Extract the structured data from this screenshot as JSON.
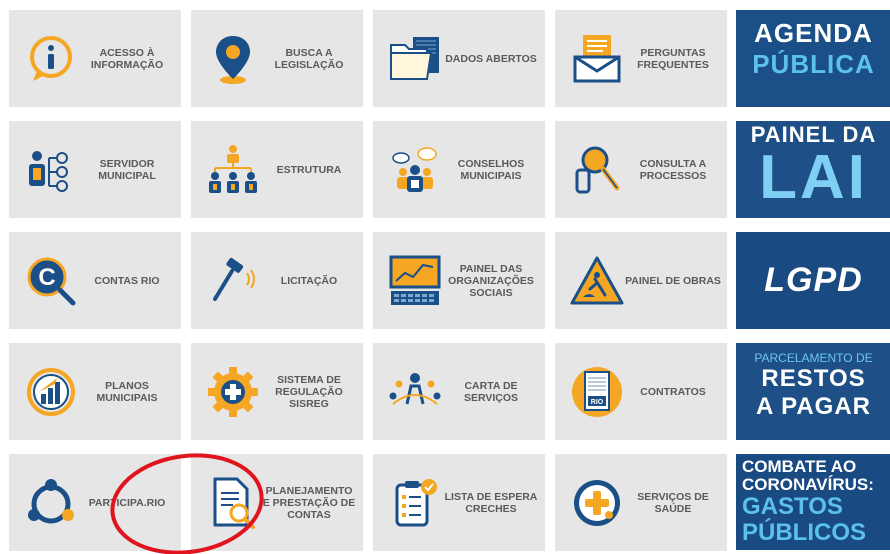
{
  "tiles": [
    {
      "label": "ACESSO À INFORMAÇÃO"
    },
    {
      "label": "BUSCA A LEGISLAÇÃO"
    },
    {
      "label": "DADOS ABERTOS"
    },
    {
      "label": "PERGUNTAS FREQUENTES"
    },
    {
      "label": "SERVIDOR MUNICIPAL"
    },
    {
      "label": "ESTRUTURA"
    },
    {
      "label": "CONSELHOS MUNICIPAIS"
    },
    {
      "label": "CONSULTA A PROCESSOS"
    },
    {
      "label": "CONTAS RIO"
    },
    {
      "label": "LICITAÇÃO"
    },
    {
      "label": "PAINEL DAS ORGANIZAÇÕES SOCIAIS"
    },
    {
      "label": "PAINEL DE OBRAS"
    },
    {
      "label": "PLANOS MUNICIPAIS"
    },
    {
      "label": "SISTEMA DE REGULAÇÃO SISREG"
    },
    {
      "label": "CARTA DE SERVIÇOS"
    },
    {
      "label": "CONTRATOS"
    },
    {
      "label": "PARTICIPA.RIO"
    },
    {
      "label": "PLANEJAMENTO E PRESTAÇÃO DE CONTAS"
    },
    {
      "label": "LISTA DE ESPERA CRECHES"
    },
    {
      "label": "SERVIÇOS DE SAÚDE"
    }
  ],
  "banners": {
    "agenda": {
      "line1": "AGENDA",
      "line2": "PÚBLICA"
    },
    "painel_lai": {
      "line1": "PAINEL DA",
      "line2": "LAI"
    },
    "lgpd": {
      "line1": "LGPD"
    },
    "restos": {
      "line1": "PARCELAMENTO DE",
      "line2": "RESTOS",
      "line3": "A PAGAR"
    },
    "coronavirus": {
      "line1": "COMBATE AO",
      "line2": "CORONAVÍRUS:",
      "line3": "GASTOS",
      "line4": "PÚBLICOS"
    }
  },
  "annotation": {
    "color": "#e0141e"
  },
  "colors": {
    "icon_blue": "#1a4f87",
    "icon_orange": "#f5a623",
    "tile_bg": "#e6e6e6",
    "banner_bg": "#1a4f87",
    "banner_accent": "#5bc0ee"
  }
}
